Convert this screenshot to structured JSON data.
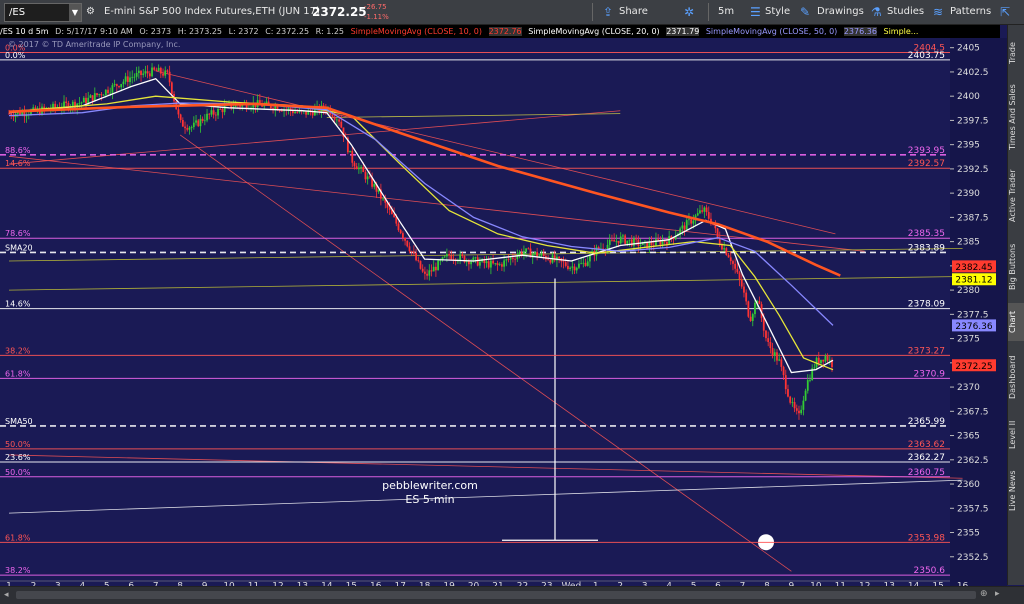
{
  "toolbar": {
    "symbol": "/ES",
    "description": "E-mini S&P 500 Index Futures,ETH (JUN 17)",
    "price": "2372.25",
    "change": "-26.75",
    "change_pct": "-1.11%",
    "share": "Share",
    "interval": "5m",
    "style": "Style",
    "drawings": "Drawings",
    "studies": "Studies",
    "patterns": "Patterns"
  },
  "info_bar": {
    "chart_label": "/ES 10 d 5m",
    "datetime": "D: 5/17/17 9:10 AM",
    "open": "O: 2373",
    "high": "H: 2373.25",
    "low": "L: 2372",
    "close": "C: 2372.25",
    "range": "R: 1.25",
    "sma10_label": "SimpleMovingAvg (CLOSE, 10, 0)",
    "sma10_value": "2372.76",
    "sma20_label": "SimpleMovingAvg (CLOSE, 20, 0)",
    "sma20_value": "2371.79",
    "sma50_label": "SimpleMovingAvg (CLOSE, 50, 0)",
    "sma50_value": "2376.36",
    "sma_extra": "Simple..."
  },
  "copyright": "© 2017 © TD Ameritrade IP Company, Inc.",
  "watermark": {
    "line1": "pebblewriter.com",
    "line2": "ES 5-min"
  },
  "right_tabs": [
    "Trade",
    "Times And Sales",
    "Active Trader",
    "Big Buttons",
    "Chart",
    "Dashboard",
    "Level II",
    "Live News"
  ],
  "active_right_tab": "Chart",
  "colors": {
    "background": "#1a1a55",
    "sma10": "#ffffff",
    "sma20": "#e6e639",
    "sma50": "#8888ff",
    "sma200": "#ff5522",
    "fib_magenta": "#ee66ee",
    "fib_red": "#ff4444",
    "candle_up": "#33cc33",
    "candle_down": "#ff3333"
  },
  "chart_data": {
    "type": "candlestick",
    "ylim": [
      2350,
      2406
    ],
    "y_ticks": [
      "2405",
      "2402.5",
      "2400",
      "2397.5",
      "2395",
      "2392.5",
      "2390",
      "2387.5",
      "2385",
      "2382.5",
      "2380",
      "2377.5",
      "2375",
      "2372.5",
      "2370",
      "2367.5",
      "2365",
      "2362.5",
      "2360",
      "2357.5",
      "2355",
      "2352.5"
    ],
    "x_ticks": [
      "1",
      "2",
      "3",
      "4",
      "5",
      "6",
      "7",
      "8",
      "9",
      "10",
      "11",
      "12",
      "13",
      "14",
      "15",
      "16",
      "17",
      "18",
      "19",
      "20",
      "21",
      "22",
      "23",
      "Wed",
      "1",
      "2",
      "3",
      "4",
      "5",
      "6",
      "7",
      "8",
      "9",
      "10",
      "11",
      "12",
      "13",
      "14",
      "15",
      "16"
    ],
    "price_path": [
      [
        0,
        2398.2
      ],
      [
        1,
        2398.4
      ],
      [
        2,
        2398.9
      ],
      [
        3,
        2399.4
      ],
      [
        4,
        2400.6
      ],
      [
        5,
        2402.0
      ],
      [
        6,
        2402.6
      ],
      [
        6.5,
        2402.2
      ],
      [
        7,
        2397.2
      ],
      [
        7.5,
        2396.8
      ],
      [
        8,
        2397.8
      ],
      [
        9,
        2399.0
      ],
      [
        10,
        2399.2
      ],
      [
        11,
        2398.9
      ],
      [
        12,
        2398.2
      ],
      [
        13,
        2398.8
      ],
      [
        13.5,
        2397.6
      ],
      [
        14,
        2393.5
      ],
      [
        15,
        2390.5
      ],
      [
        16,
        2386.2
      ],
      [
        17,
        2381.4
      ],
      [
        18,
        2383.6
      ],
      [
        19,
        2383.0
      ],
      [
        20,
        2382.5
      ],
      [
        21,
        2384.0
      ],
      [
        22,
        2383.4
      ],
      [
        23,
        2382.4
      ],
      [
        23.5,
        2382.7
      ],
      [
        24,
        2384.1
      ],
      [
        25,
        2385.3
      ],
      [
        26,
        2384.6
      ],
      [
        27,
        2385.2
      ],
      [
        28,
        2387.4
      ],
      [
        28.4,
        2388.3
      ],
      [
        28.8,
        2386.8
      ],
      [
        29,
        2385.2
      ],
      [
        29.5,
        2383.4
      ],
      [
        30,
        2380.2
      ],
      [
        30.3,
        2377.0
      ],
      [
        30.6,
        2379.2
      ],
      [
        31,
        2374.6
      ],
      [
        31.5,
        2372.6
      ],
      [
        32,
        2368.2
      ],
      [
        32.3,
        2366.8
      ],
      [
        32.6,
        2370.2
      ],
      [
        33,
        2372.6
      ],
      [
        33.4,
        2373.2
      ],
      [
        33.7,
        2372.3
      ]
    ],
    "series": [
      {
        "name": "SimpleMovingAvg (CLOSE, 10, 0)",
        "color": "#ffffff",
        "points": [
          [
            0,
            2398.3
          ],
          [
            3,
            2399.0
          ],
          [
            5,
            2401.0
          ],
          [
            6,
            2401.8
          ],
          [
            7,
            2399.2
          ],
          [
            9,
            2398.8
          ],
          [
            12,
            2398.5
          ],
          [
            13,
            2398.3
          ],
          [
            14,
            2395.0
          ],
          [
            15,
            2391.0
          ],
          [
            16,
            2387.0
          ],
          [
            17,
            2383.2
          ],
          [
            19,
            2383.0
          ],
          [
            21,
            2383.6
          ],
          [
            23,
            2383.0
          ],
          [
            25,
            2384.6
          ],
          [
            27,
            2385.2
          ],
          [
            28.5,
            2387.2
          ],
          [
            29.3,
            2386.3
          ],
          [
            30,
            2381.6
          ],
          [
            31,
            2376.6
          ],
          [
            32,
            2371.5
          ],
          [
            33,
            2371.8
          ],
          [
            33.7,
            2372.76
          ]
        ]
      },
      {
        "name": "SimpleMovingAvg (CLOSE, 20, 0)",
        "color": "#e6e639",
        "points": [
          [
            0,
            2398.4
          ],
          [
            4,
            2399.2
          ],
          [
            6,
            2400.0
          ],
          [
            9,
            2399.4
          ],
          [
            12,
            2399.0
          ],
          [
            14,
            2398.0
          ],
          [
            16,
            2393.0
          ],
          [
            18,
            2388.2
          ],
          [
            20,
            2385.8
          ],
          [
            22,
            2384.6
          ],
          [
            24,
            2383.8
          ],
          [
            26,
            2384.4
          ],
          [
            28,
            2385.0
          ],
          [
            29.5,
            2384.6
          ],
          [
            30.5,
            2381.4
          ],
          [
            31.5,
            2377.4
          ],
          [
            32.5,
            2373.0
          ],
          [
            33.7,
            2371.79
          ]
        ]
      },
      {
        "name": "SimpleMovingAvg (CLOSE, 50, 0)",
        "color": "#8888ff",
        "points": [
          [
            0,
            2398.0
          ],
          [
            3,
            2398.3
          ],
          [
            5,
            2399.0
          ],
          [
            7,
            2399.3
          ],
          [
            10,
            2399.2
          ],
          [
            13,
            2398.6
          ],
          [
            15,
            2395.5
          ],
          [
            17,
            2391.0
          ],
          [
            19,
            2387.5
          ],
          [
            21,
            2385.5
          ],
          [
            23,
            2384.5
          ],
          [
            25,
            2384.0
          ],
          [
            27,
            2384.4
          ],
          [
            29,
            2385.4
          ],
          [
            30.5,
            2384.0
          ],
          [
            32,
            2380.5
          ],
          [
            33.7,
            2376.36
          ]
        ]
      },
      {
        "name": "",
        "color": "#ff5522",
        "points": [
          [
            0,
            2398.4
          ],
          [
            5,
            2398.9
          ],
          [
            10,
            2399.2
          ],
          [
            13,
            2398.8
          ],
          [
            16,
            2396.2
          ],
          [
            20,
            2392.8
          ],
          [
            24,
            2390.0
          ],
          [
            27,
            2388.0
          ],
          [
            29,
            2386.8
          ],
          [
            31,
            2385.0
          ],
          [
            33,
            2382.6
          ],
          [
            34,
            2381.5
          ]
        ]
      }
    ],
    "horizontal_levels": [
      {
        "label": "2404.5",
        "value": 2404.5,
        "color": "#ff5555",
        "left_label": "0.0%"
      },
      {
        "label": "2403.75",
        "value": 2403.75,
        "color": "#ffffff",
        "left_label": "0.0%"
      },
      {
        "label": "2393.95",
        "value": 2393.95,
        "color": "#ee66ee",
        "left_label": "88.6%",
        "dashed": true
      },
      {
        "label": "2392.57",
        "value": 2392.57,
        "color": "#ff5555",
        "left_label": "14.6%"
      },
      {
        "label": "2385.35",
        "value": 2385.35,
        "color": "#ee66ee",
        "left_label": "78.6%"
      },
      {
        "label": "2383.89",
        "value": 2383.89,
        "color": "#ffffff",
        "left_label": "SMA20",
        "dashed": true
      },
      {
        "label": "2378.09",
        "value": 2378.09,
        "color": "#ffffff",
        "left_label": "14.6%"
      },
      {
        "label": "2373.27",
        "value": 2373.27,
        "color": "#ff5555",
        "left_label": "38.2%"
      },
      {
        "label": "2370.9",
        "value": 2370.9,
        "color": "#ee66ee",
        "left_label": "61.8%"
      },
      {
        "label": "2365.99",
        "value": 2365.99,
        "color": "#ffffff",
        "left_label": "SMA50",
        "dashed": true
      },
      {
        "label": "2363.62",
        "value": 2363.62,
        "color": "#ff5555",
        "left_label": "50.0%"
      },
      {
        "label": "2362.27",
        "value": 2362.27,
        "color": "#ffffff",
        "left_label": "23.6%"
      },
      {
        "label": "2360.75",
        "value": 2360.75,
        "color": "#ee66ee",
        "left_label": "50.0%"
      },
      {
        "label": "2353.98",
        "value": 2353.98,
        "color": "#ff5555",
        "left_label": "61.8%"
      },
      {
        "label": "2350.6",
        "value": 2350.6,
        "color": "#ee66ee",
        "left_label": "38.2%"
      }
    ],
    "price_badges": [
      {
        "label": "2382.45",
        "value": 2382.45,
        "color": "#ff3b2f",
        "text_color": "#000000"
      },
      {
        "label": "2381.12",
        "value": 2381.12,
        "color": "#ffff00",
        "text_color": "#000000"
      },
      {
        "label": "2376.36",
        "value": 2376.36,
        "color": "#8888ff",
        "text_color": "#000000"
      },
      {
        "label": "2372.25",
        "value": 2372.25,
        "color": "#ff3b2f",
        "text_color": "#000000"
      }
    ]
  }
}
